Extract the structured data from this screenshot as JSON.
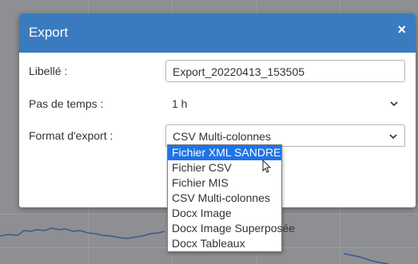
{
  "modal": {
    "title": "Export",
    "close_glyph": "×"
  },
  "form": {
    "libelle": {
      "label": "Libellé :",
      "value": "Export_20220413_153505"
    },
    "pas_de_temps": {
      "label": "Pas de temps :",
      "value": "1 h"
    },
    "format_export": {
      "label": "Format d'export :",
      "value": "CSV Multi-colonnes"
    }
  },
  "dropdown": {
    "options": [
      "Fichier XML SANDRE",
      "Fichier CSV",
      "Fichier MIS",
      "CSV Multi-colonnes",
      "Docx Image",
      "Docx Image Superposée",
      "Docx Tableaux"
    ],
    "highlighted": "Fichier XML SANDRE"
  },
  "colors": {
    "header": "#3a7bbf",
    "highlight": "#1e73e8",
    "overlay": "#8d8f93"
  }
}
